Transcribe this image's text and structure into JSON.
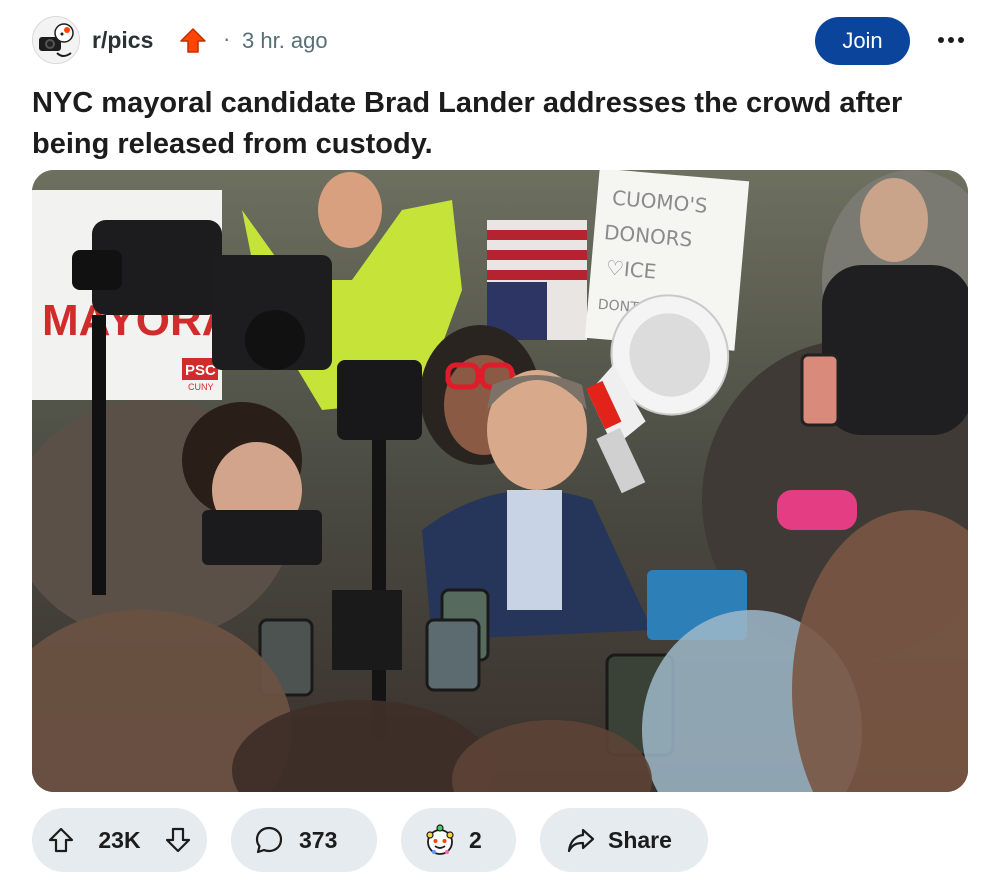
{
  "post": {
    "subreddit": "r/pics",
    "separator": "·",
    "time_ago": "3 hr. ago",
    "join_label": "Join",
    "title": "NYC mayoral candidate Brad Lander addresses the crowd after being released from custody.",
    "image_alt": "NYC mayoral candidate Brad Lander addresses the crowd after being released from custody.",
    "image_signs": {
      "left_sign": "MAYORA",
      "left_sign_logo": "PSC",
      "left_sign_sub": "CUNY",
      "right_sign_line1": "CUOMO'S",
      "right_sign_line2": "DONORS",
      "right_sign_line3": "♡ICE",
      "right_sign_line4": "DONT RANK"
    }
  },
  "actions": {
    "votes": "23K",
    "comments": "373",
    "awards": "2",
    "share_label": "Share"
  },
  "colors": {
    "join_button": "#0a449b",
    "pill_background": "#e5ebee",
    "award_arrow": "#ff4500",
    "meta_text": "#576f76"
  },
  "icons": {
    "award": "orange-up-arrow",
    "upvote": "up-arrow-outline",
    "downvote": "down-arrow-outline",
    "comment": "speech-bubble",
    "award_pill": "snoo-award",
    "share": "share-arrow",
    "more": "three-dots"
  }
}
